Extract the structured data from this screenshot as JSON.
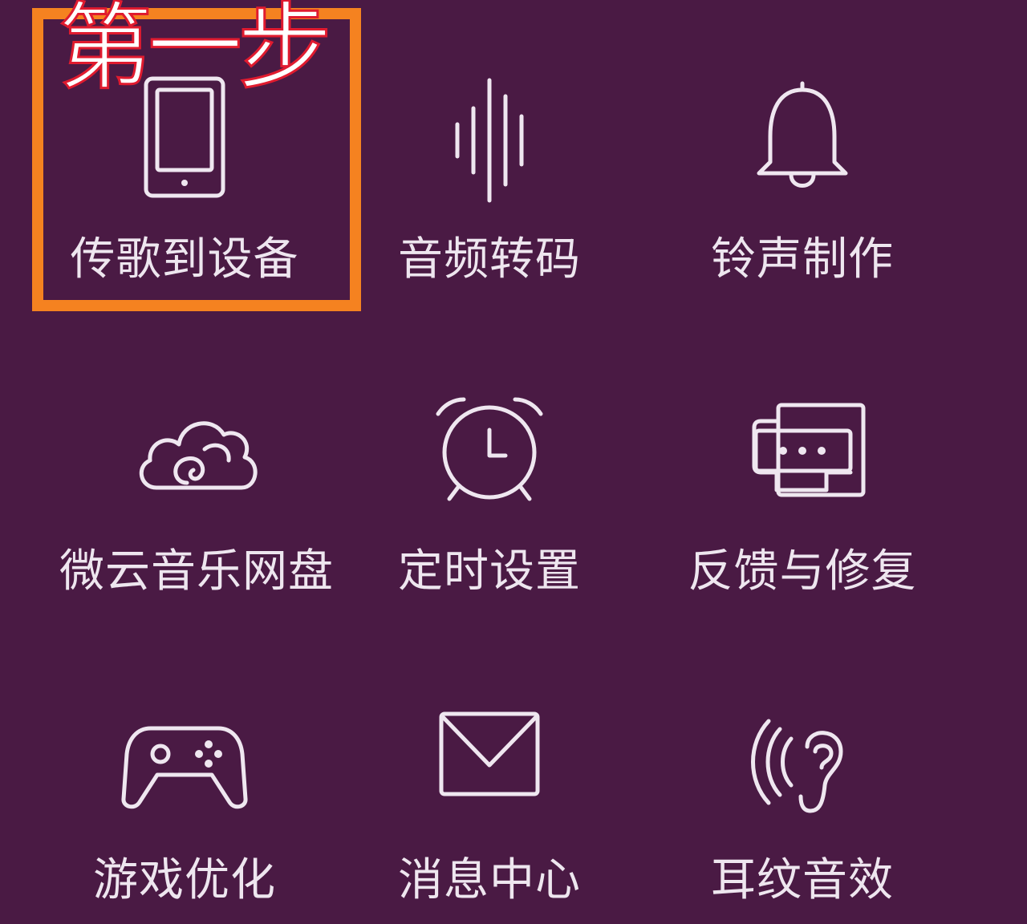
{
  "annotation": {
    "step_text": "第一步",
    "highlight_color": "#f58220",
    "text_outline_color": "#e01b2f"
  },
  "theme": {
    "background": "#4a1a44",
    "foreground": "#eee6ef"
  },
  "tiles": [
    {
      "label": "传歌到设备",
      "icon": "phone-icon"
    },
    {
      "label": "音频转码",
      "icon": "sound-wave-icon"
    },
    {
      "label": "铃声制作",
      "icon": "bell-icon"
    },
    {
      "label": "微云音乐网盘",
      "icon": "cloud-icon"
    },
    {
      "label": "定时设置",
      "icon": "alarm-clock-icon"
    },
    {
      "label": "反馈与修复",
      "icon": "feedback-chat-icon"
    },
    {
      "label": "游戏优化",
      "icon": "gamepad-icon"
    },
    {
      "label": "消息中心",
      "icon": "envelope-icon"
    },
    {
      "label": "耳纹音效",
      "icon": "ear-icon"
    }
  ]
}
